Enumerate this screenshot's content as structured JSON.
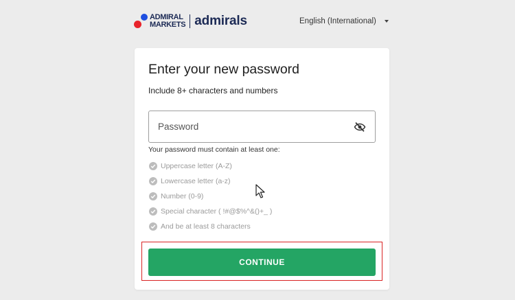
{
  "header": {
    "logo": {
      "line1": "ADMIRAL",
      "line2": "MARKETS",
      "brand": "admirals"
    },
    "language": "English (International)"
  },
  "card": {
    "title": "Enter your new password",
    "subtitle": "Include 8+ characters and numbers",
    "password_field": {
      "placeholder": "Password",
      "icon": "eye-slash-icon"
    },
    "requirements_heading": "Your password must contain at least one:",
    "requirements": [
      "Uppercase letter (A-Z)",
      "Lowercase letter (a-z)",
      "Number (0-9)",
      "Special character ( !#@$%^&()+_ )",
      "And be at least 8 characters"
    ],
    "continue_label": "CONTINUE"
  },
  "colors": {
    "button_green": "#24a564",
    "brand_navy": "#1c2a55",
    "logo_blue": "#1f4fe0",
    "logo_red": "#e8232b",
    "highlight_red": "#d92222",
    "check_grey": "#bdbdbd"
  }
}
